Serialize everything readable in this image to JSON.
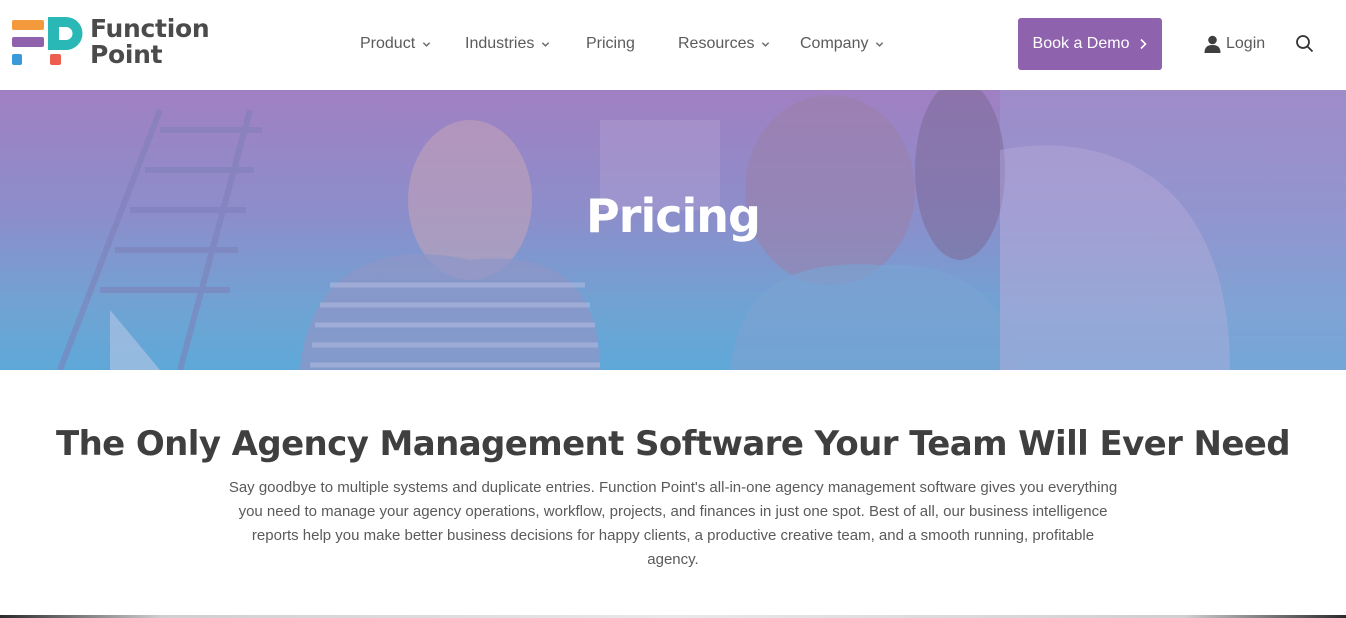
{
  "brand": {
    "line1": "Function",
    "line2": "Point",
    "colors": {
      "orange": "#f39b3c",
      "purple": "#8e62ad",
      "teal": "#29b8b5",
      "blue": "#3a9ad9",
      "red": "#ec5f4f"
    }
  },
  "nav": {
    "items": [
      {
        "label": "Product",
        "dropdown": true
      },
      {
        "label": "Industries",
        "dropdown": true
      },
      {
        "label": "Pricing",
        "dropdown": false
      },
      {
        "label": "Resources",
        "dropdown": true
      },
      {
        "label": "Company",
        "dropdown": true
      }
    ],
    "demo_label": "Book a Demo",
    "login_label": "Login",
    "icons": {
      "chevron": "chevron-down-icon",
      "arrow": "chevron-right-icon",
      "user": "user-icon",
      "search": "search-icon"
    }
  },
  "hero": {
    "title": "Pricing",
    "gradient": [
      "#a080c2",
      "#5ea8d8"
    ]
  },
  "content": {
    "title": "The Only Agency Management Software Your Team Will Ever Need",
    "body": "Say goodbye to multiple systems and duplicate entries. Function Point's all-in-one agency management software gives you everything you need to manage your agency operations, workflow, projects, and finances in just one spot. Best of all, our business intelligence reports help you make better business decisions for happy clients, a productive creative team, and a smooth running, profitable agency."
  },
  "accent_color": "#8e62ad"
}
